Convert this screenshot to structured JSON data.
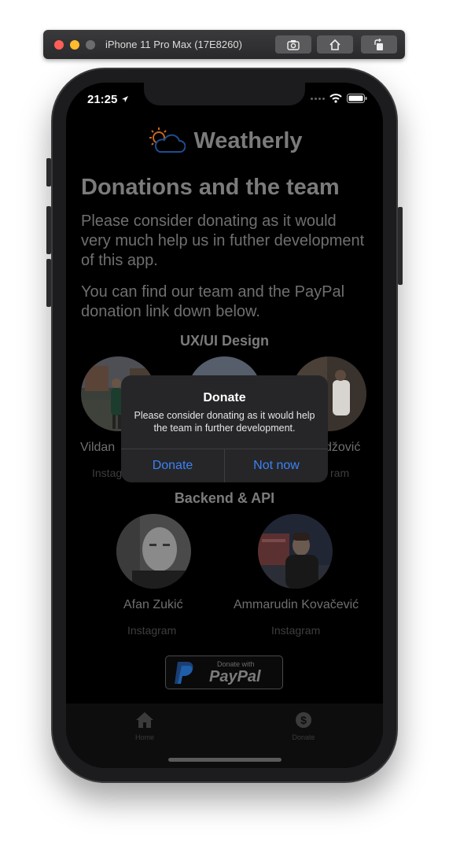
{
  "simulator": {
    "title": "iPhone 11 Pro Max (17E8260)",
    "buttons": [
      "screenshot-icon",
      "home-icon",
      "rotate-icon"
    ]
  },
  "status_bar": {
    "time": "21:25"
  },
  "app": {
    "name": "Weatherly",
    "heading": "Donations and the team",
    "paragraph1": "Please consider donating as it would very much help us in futher development of this app.",
    "paragraph2": "You can find our team and the PayPal donation link down below.",
    "sections": {
      "design": {
        "title": "UX/UI Design",
        "people": [
          {
            "name": "Vildan ",
            "link": "Instag"
          },
          {
            "name": "džović",
            "link": "ram"
          }
        ]
      },
      "backend": {
        "title": "Backend & API",
        "people": [
          {
            "name": "Afan Zukić",
            "link": "Instagram"
          },
          {
            "name": "Ammarudin Kovačević",
            "link": "Instagram"
          }
        ]
      }
    },
    "paypal": {
      "small": "Donate with",
      "big": "PayPal"
    },
    "tabs": [
      {
        "label": "Home",
        "icon": "home-icon"
      },
      {
        "label": "Donate",
        "icon": "dollar-icon"
      }
    ]
  },
  "alert": {
    "title": "Donate",
    "message": "Please consider donating as it would help the team in further development.",
    "primary": "Donate",
    "secondary": "Not now"
  }
}
